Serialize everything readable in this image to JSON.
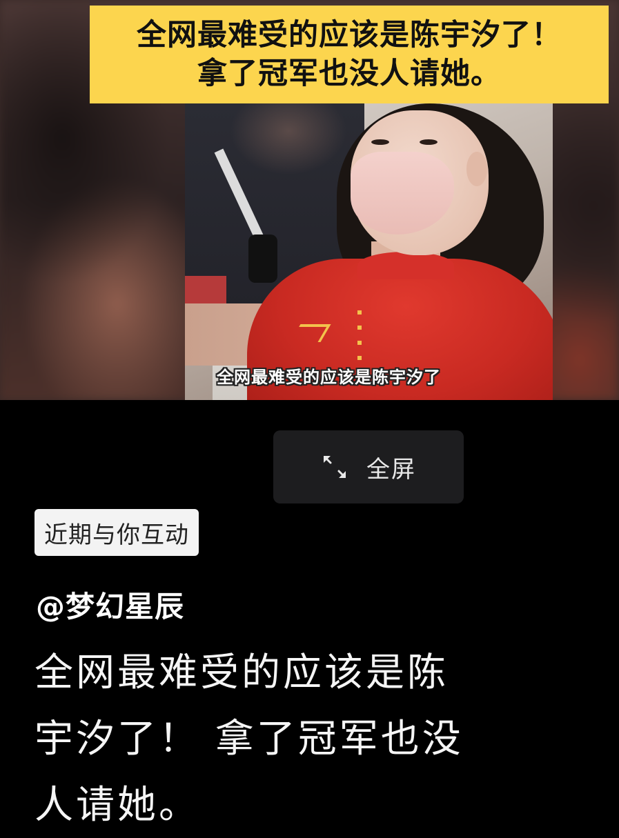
{
  "video": {
    "headline_line1": "全网最难受的应该是陈宇汐了！",
    "headline_line2": "拿了冠军也没人请她。",
    "subtitle": "全网最难受的应该是陈宇汐了",
    "headline_bg_color": "#fcd54e"
  },
  "controls": {
    "fullscreen_icon": "expand-arrows-icon",
    "fullscreen_label": "全屏"
  },
  "badge": {
    "label": "近期与你互动"
  },
  "post": {
    "author": "@梦幻星辰",
    "caption_lines": [
      "全网最难受的应该是陈",
      "宇汐了！ 拿了冠军也没",
      "人请她。"
    ]
  }
}
